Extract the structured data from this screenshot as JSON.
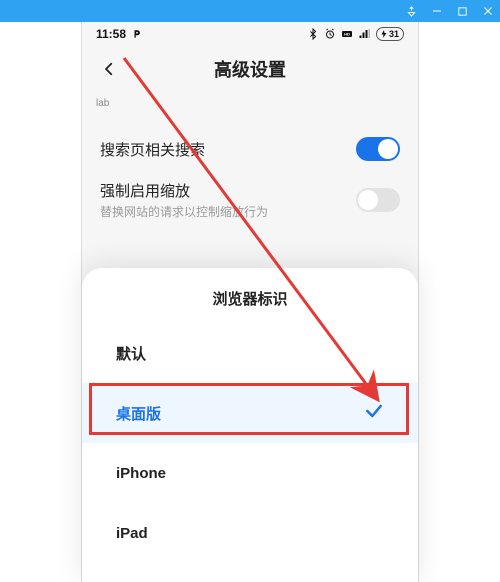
{
  "window": {
    "title": ""
  },
  "statusbar": {
    "time": "11:58",
    "battery": "31"
  },
  "header": {
    "title": "高级设置"
  },
  "badge": "lab",
  "settings": {
    "search_related": {
      "label": "搜索页相关搜索",
      "on": true
    },
    "force_zoom": {
      "label": "强制启用缩放",
      "sub": "替换网站的请求以控制缩放行为",
      "on": false
    }
  },
  "sheet": {
    "title": "浏览器标识",
    "items": [
      {
        "label": "默认",
        "selected": false
      },
      {
        "label": "桌面版",
        "selected": true
      },
      {
        "label": "iPhone",
        "selected": false
      },
      {
        "label": "iPad",
        "selected": false
      }
    ]
  }
}
